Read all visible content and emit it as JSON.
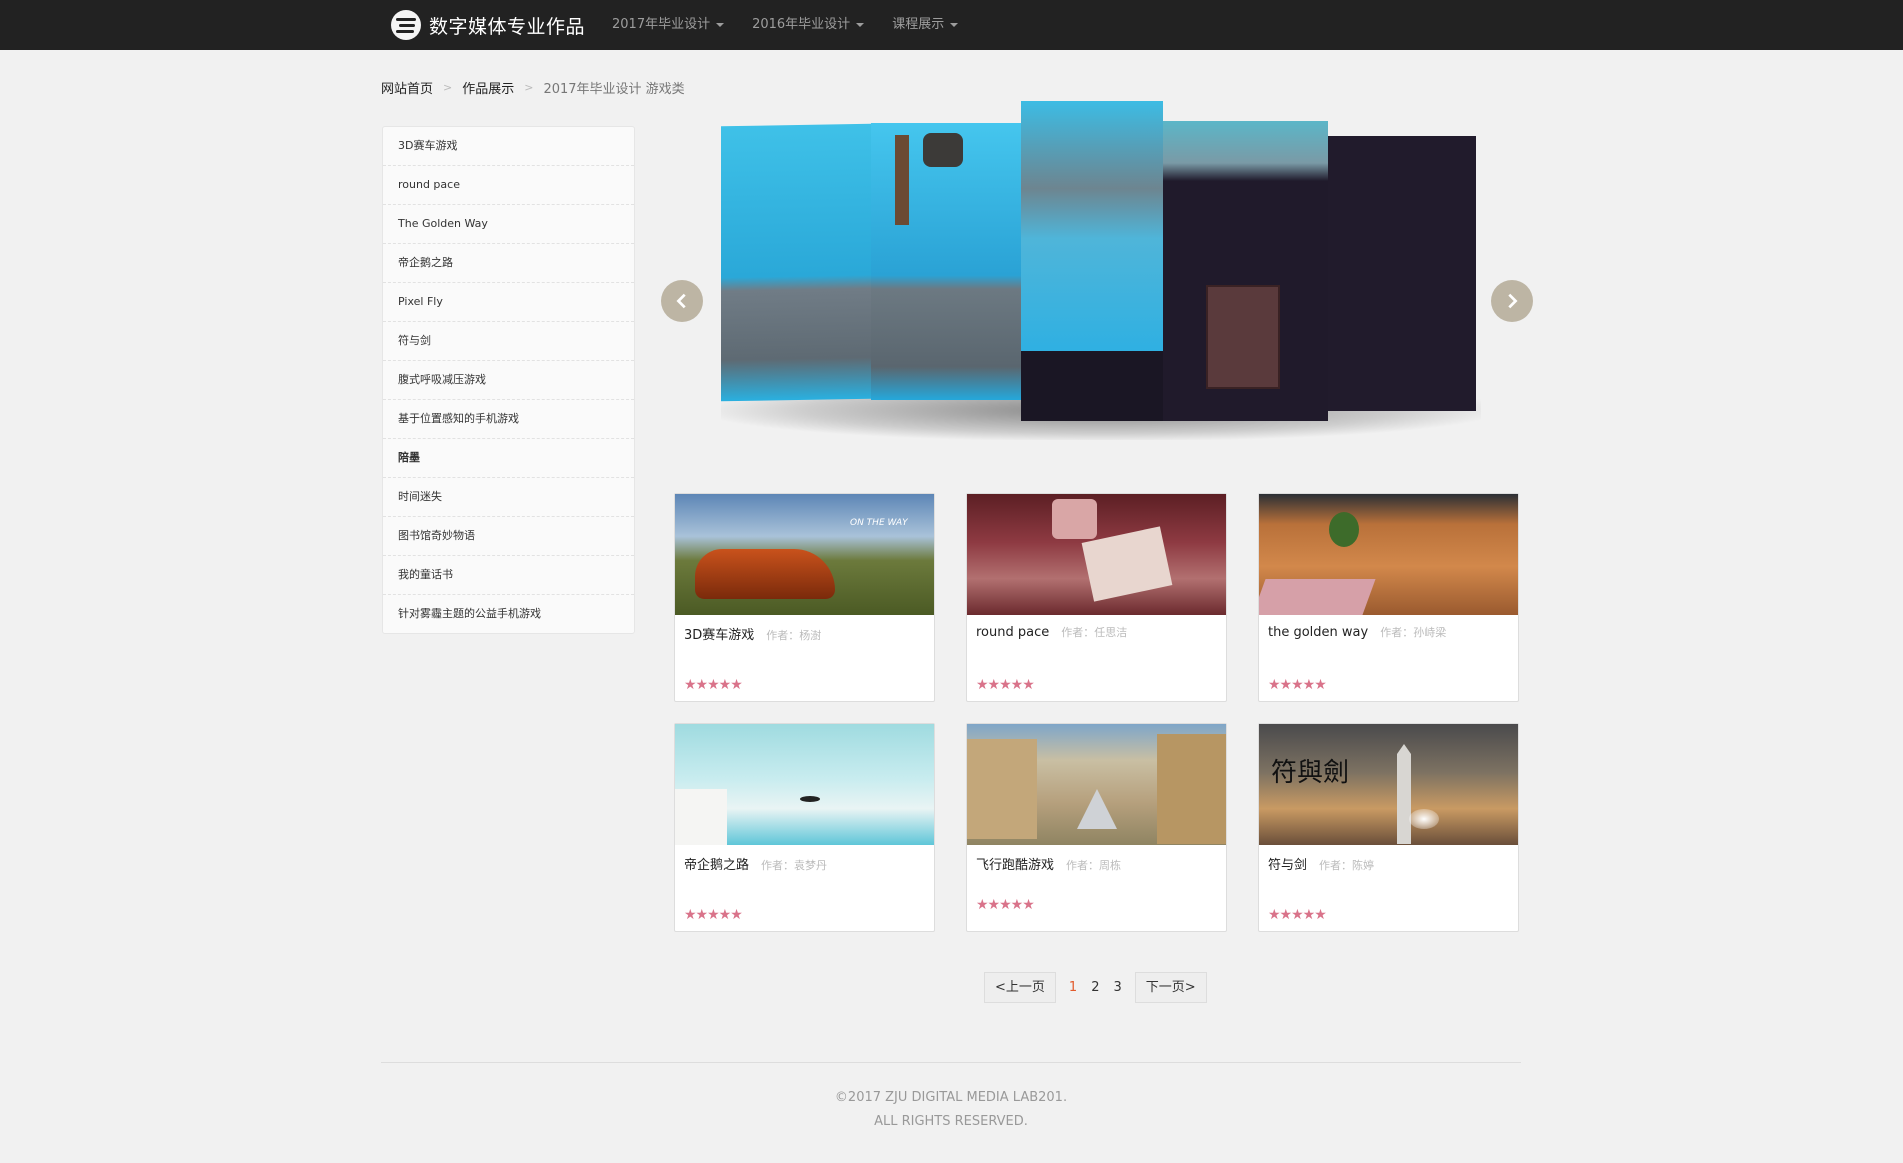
{
  "header": {
    "brand_title": "数字媒体专业作品",
    "menu": [
      {
        "label": "2017年毕业设计"
      },
      {
        "label": "2016年毕业设计"
      },
      {
        "label": "课程展示"
      }
    ]
  },
  "breadcrumb": {
    "home": "网站首页",
    "section": "作品展示",
    "current": "2017年毕业设计 游戏类"
  },
  "sidebar": {
    "items": [
      {
        "label": "3D赛车游戏"
      },
      {
        "label": "round pace"
      },
      {
        "label": "The Golden Way"
      },
      {
        "label": "帝企鹅之路"
      },
      {
        "label": "Pixel Fly"
      },
      {
        "label": "符与剑"
      },
      {
        "label": "腹式呼吸减压游戏"
      },
      {
        "label": "基于位置感知的手机游戏"
      },
      {
        "label": "陪墨"
      },
      {
        "label": "时间迷失"
      },
      {
        "label": "图书馆奇妙物语"
      },
      {
        "label": "我的童话书"
      },
      {
        "label": "针对雾霾主题的公益手机游戏"
      }
    ]
  },
  "carousel": {
    "prev_icon": "chevron-left-icon",
    "next_icon": "chevron-right-icon"
  },
  "cards": [
    {
      "title": "3D赛车游戏",
      "author": "作者：杨澍",
      "stars": "★★★★★",
      "overlay_text": "ON THE WAY"
    },
    {
      "title": "round pace",
      "author": "作者：任思洁",
      "stars": "★★★★★"
    },
    {
      "title": "the golden way",
      "author": "作者：孙峙梁",
      "stars": "★★★★★"
    },
    {
      "title": "帝企鹅之路",
      "author": "作者：袁梦丹",
      "stars": "★★★★★"
    },
    {
      "title": "飞行跑酷游戏",
      "author": "作者：周栋",
      "stars": "★★★★★"
    },
    {
      "title": "符与剑",
      "author": "作者：陈婷",
      "stars": "★★★★★",
      "overlay_text": "符與劍"
    }
  ],
  "pagination": {
    "prev": "<上一页",
    "pages": [
      "1",
      "2",
      "3"
    ],
    "active": "1",
    "next": "下一页>"
  },
  "footer": {
    "line1": "©2017 ZJU DIGITAL MEDIA LAB201.",
    "line2": "ALL RIGHTS RESERVED."
  },
  "colors": {
    "topbar": "#222222",
    "star": "#d9738a",
    "active_page": "#e25a2c",
    "background": "#f1f1f1"
  }
}
